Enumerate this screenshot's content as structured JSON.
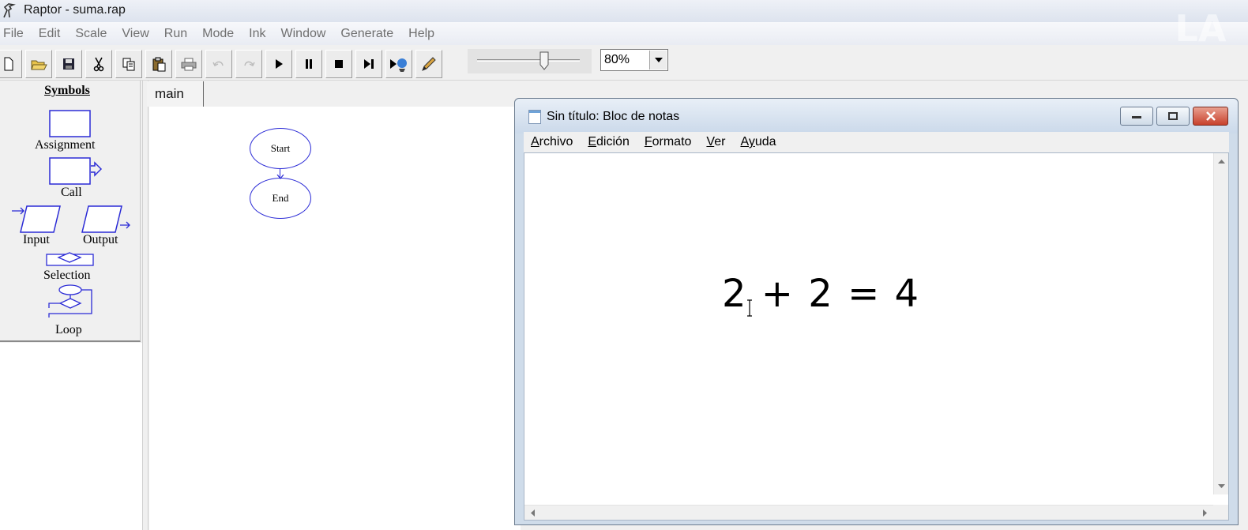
{
  "window": {
    "title": "Raptor - suma.rap"
  },
  "menubar": {
    "items": [
      "File",
      "Edit",
      "Scale",
      "View",
      "Run",
      "Mode",
      "Ink",
      "Window",
      "Generate",
      "Help"
    ]
  },
  "toolbar": {
    "buttons": [
      "new-file-icon",
      "open-folder-icon",
      "save-icon",
      "cut-icon",
      "copy-icon",
      "paste-icon",
      "print-icon",
      "undo-icon",
      "redo-icon",
      "play-icon",
      "pause-icon",
      "stop-icon",
      "step-icon",
      "run-to-completion-icon",
      "pen-icon"
    ],
    "zoom_value": "80%",
    "speed_slider_level": 0.65
  },
  "symbols": {
    "title": "Symbols",
    "assignment": "Assignment",
    "call": "Call",
    "input": "Input",
    "output": "Output",
    "selection": "Selection",
    "loop": "Loop"
  },
  "canvas": {
    "tab_label": "main",
    "start_label": "Start",
    "end_label": "End"
  },
  "notepad": {
    "title": "Sin título: Bloc de notas",
    "menu": [
      {
        "key": "A",
        "rest": "rchivo"
      },
      {
        "key": "E",
        "rest": "dición"
      },
      {
        "key": "F",
        "rest": "ormato"
      },
      {
        "key": "V",
        "rest": "er"
      },
      {
        "key": "Ay",
        "rest": "uda"
      }
    ],
    "content": "2 + 2 = 4"
  },
  "colors": {
    "flowchart_stroke": "#2b2bd6",
    "title_bar": "#dde3ee"
  }
}
